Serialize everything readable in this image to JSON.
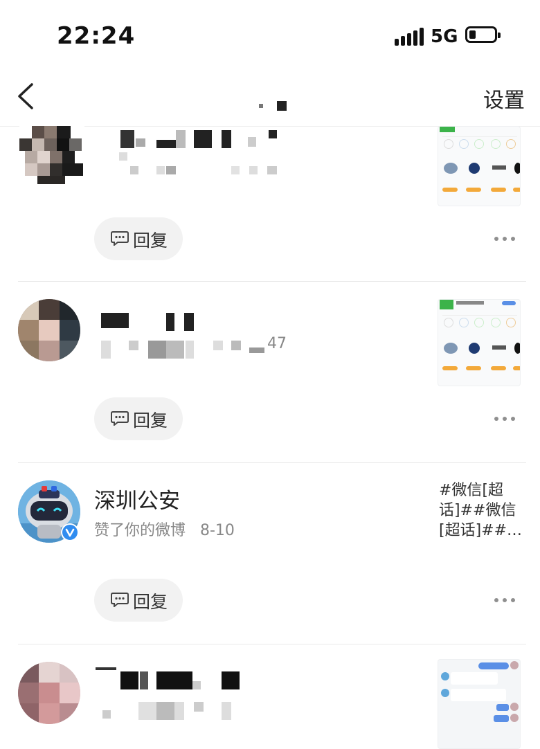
{
  "status_bar": {
    "time": "22:24",
    "network": "5G",
    "battery_level": 0.2
  },
  "nav": {
    "right_label": "设置"
  },
  "items": [
    {
      "name": "",
      "subtitle": "",
      "reply_label": "回复",
      "preview": "screenshot"
    },
    {
      "name": "",
      "subtitle": "47",
      "reply_label": "回复",
      "preview": "screenshot"
    },
    {
      "name": "深圳公安",
      "subtitle": "赞了你的微博   8-10",
      "reply_label": "回复",
      "verified": true,
      "preview_text": "#微信[超话]##微信[超话]##…"
    },
    {
      "name": "",
      "subtitle": "",
      "reply_label": "回复",
      "preview": "chat-screenshot"
    }
  ],
  "icons": {
    "back": "chevron-left-icon",
    "reply": "comment-icon",
    "more": "more-dots-icon",
    "verified": "verified-badge-icon"
  },
  "colors": {
    "verified_badge": "#2f8cf0",
    "divider": "#e9e9e9",
    "reply_bg": "#f2f2f2"
  }
}
